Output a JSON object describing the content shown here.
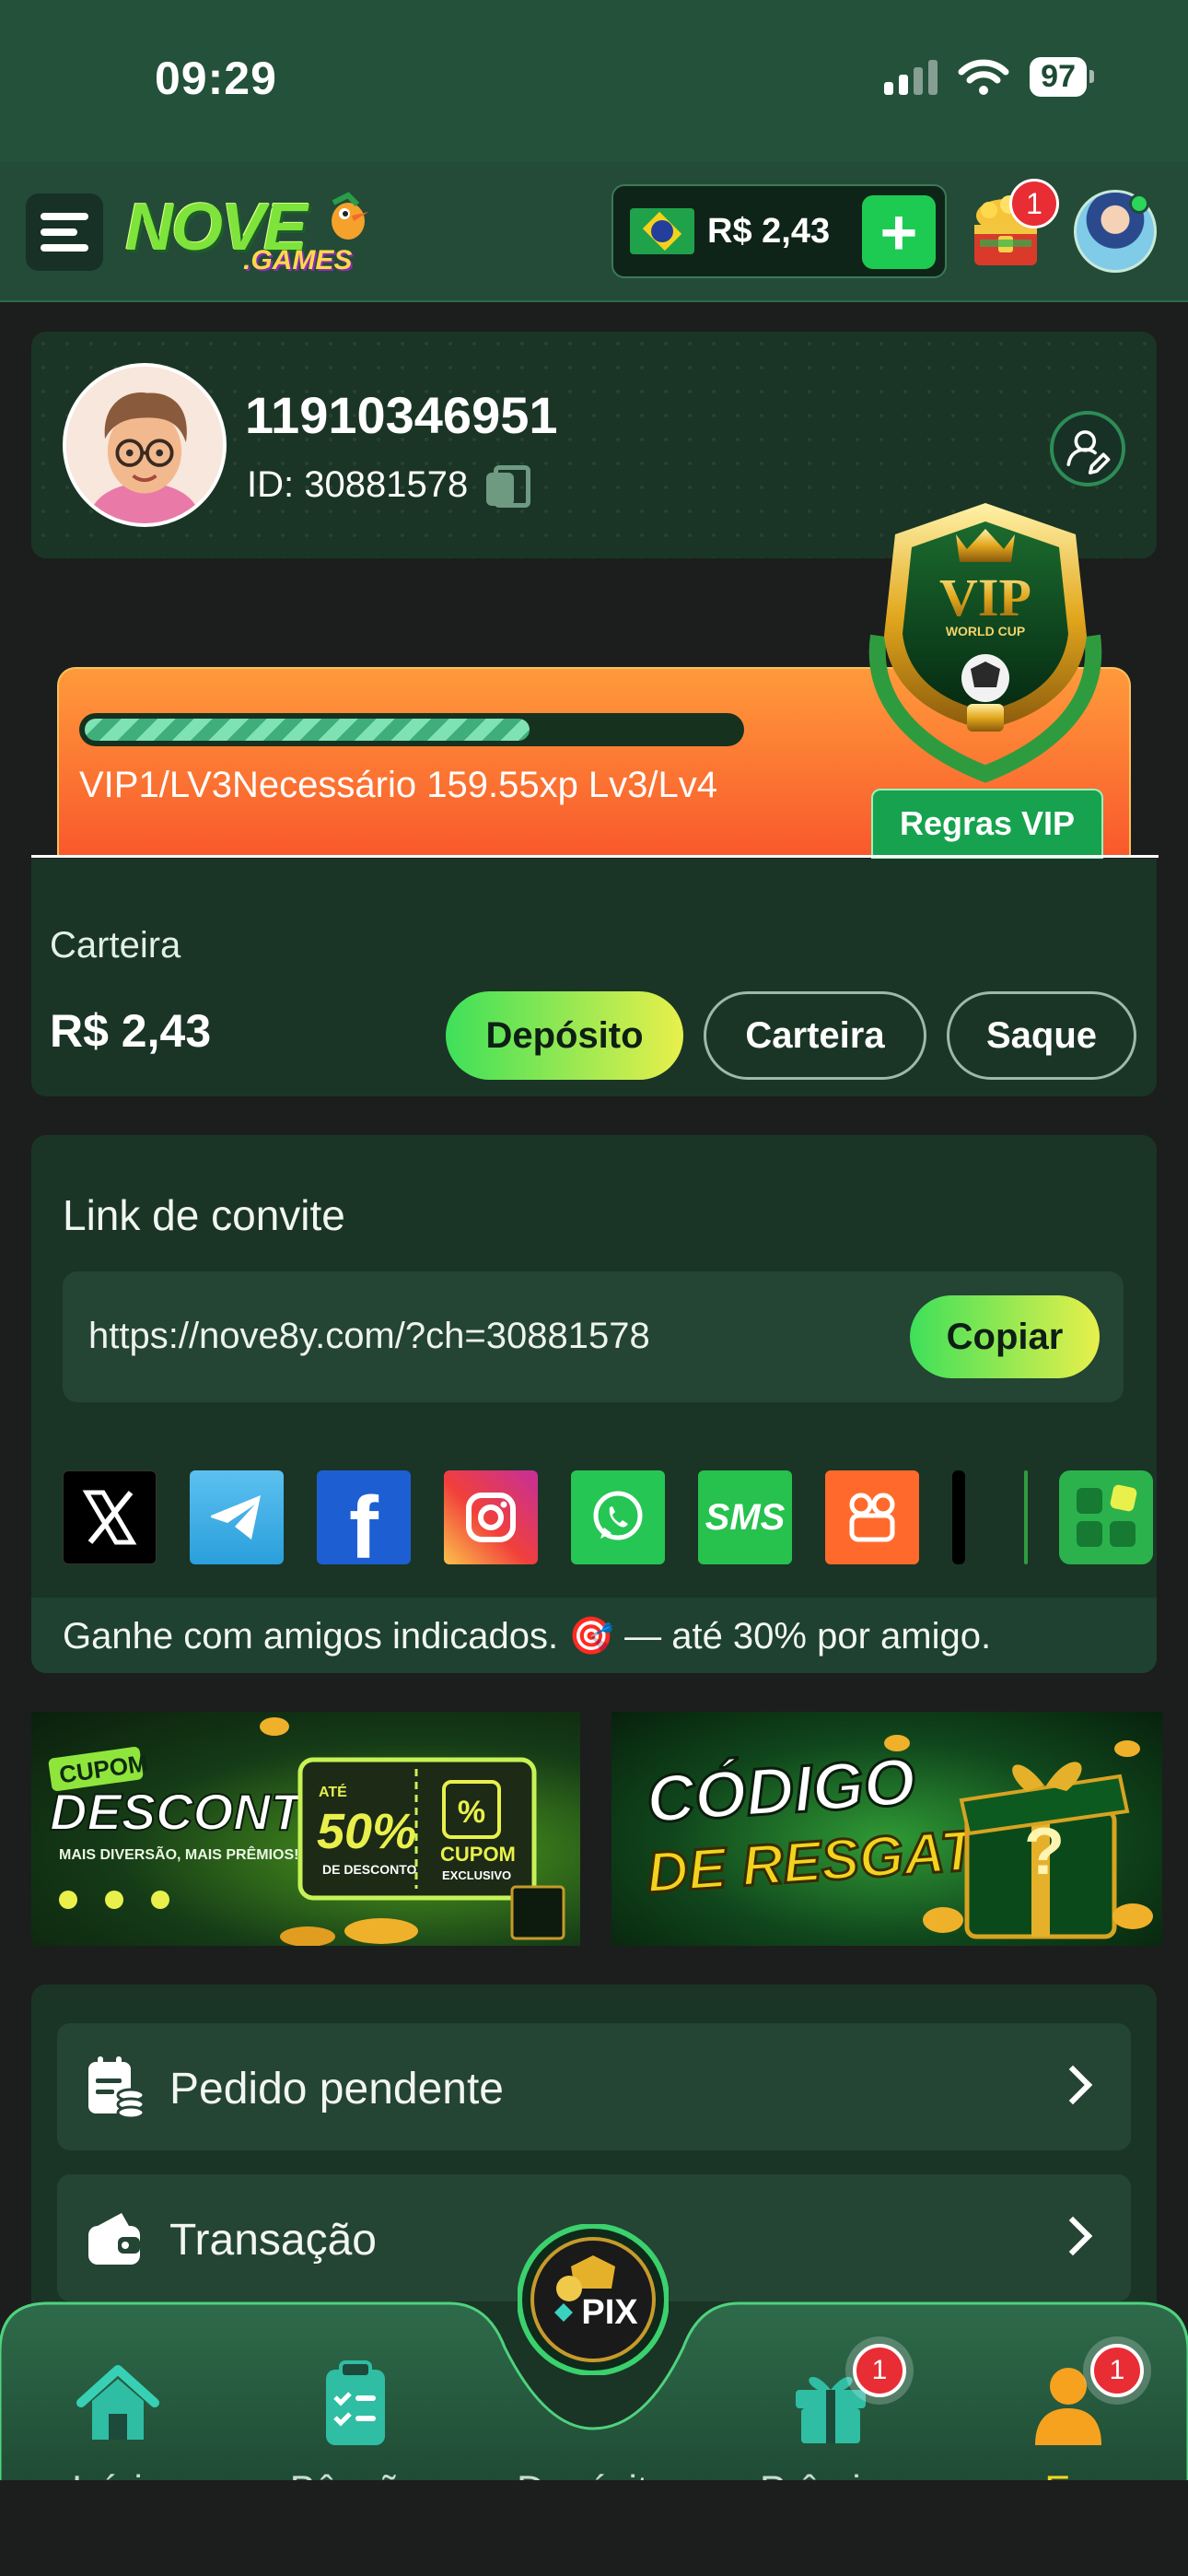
{
  "status_bar": {
    "time": "09:29",
    "battery": "97"
  },
  "header": {
    "logo_main": "NOVE",
    "logo_sub": ".GAMES",
    "balance": "R$ 2,43",
    "add_label": "+",
    "chest_badge": "1"
  },
  "profile": {
    "username": "11910346951",
    "id_text": "ID: 30881578"
  },
  "vip": {
    "progress": 0.68,
    "status_text": "VIP1/LV3Necessário 159.55xp Lv3/Lv4",
    "rules_label": "Regras VIP",
    "badge_text": "VIP",
    "badge_sub": "WORLD CUP"
  },
  "wallet": {
    "label": "Carteira",
    "amount": "R$ 2,43",
    "buttons": {
      "deposit": "Depósito",
      "wallet": "Carteira",
      "withdraw": "Saque"
    }
  },
  "invite": {
    "title": "Link de convite",
    "url": "https://nove8y.com/?ch=30881578",
    "copy_label": "Copiar",
    "share_icons": [
      "x-icon",
      "telegram-icon",
      "facebook-icon",
      "instagram-icon",
      "whatsapp-icon",
      "sms-icon",
      "kwai-icon",
      "more-apps-icon"
    ],
    "sms_label": "SMS",
    "note": "Ganhe com amigos indicados. 🎯 — até 30% por amigo."
  },
  "banners": {
    "coupon": {
      "tag": "CUPOM",
      "title": "DESCONTO",
      "subtitle": "MAIS DIVERSÃO, MAIS PRÊMIOS!",
      "percent": "50%",
      "ate": "ATÉ",
      "desc": "DE DESCONTO",
      "coupon_label": "CUPOM",
      "coupon_sub": "EXCLUSIVO"
    },
    "redeem": {
      "line1": "CÓDIGO",
      "line2": "DE RESGATE"
    }
  },
  "menu": {
    "items": [
      {
        "label": "Pedido pendente",
        "icon": "pending-order-icon"
      },
      {
        "label": "Transação",
        "icon": "wallet-icon"
      }
    ]
  },
  "bottom_nav": {
    "items": [
      {
        "label": "Início",
        "icon": "home-icon"
      },
      {
        "label": "Bênção",
        "icon": "clipboard-icon"
      },
      {
        "label": "Depósito",
        "icon": "pix-icon"
      },
      {
        "label": "Prêmios",
        "icon": "gift-icon",
        "badge": "1"
      },
      {
        "label": "Eu",
        "icon": "user-icon",
        "badge": "1"
      }
    ],
    "pix_label": "PIX",
    "active": "Eu",
    "active_color": "#f2d41f"
  },
  "colors": {
    "accent_green": "#1ecb52",
    "card_bg": "#1a3526",
    "vip_orange": "#f9582c",
    "badge_red": "#e82d35"
  }
}
